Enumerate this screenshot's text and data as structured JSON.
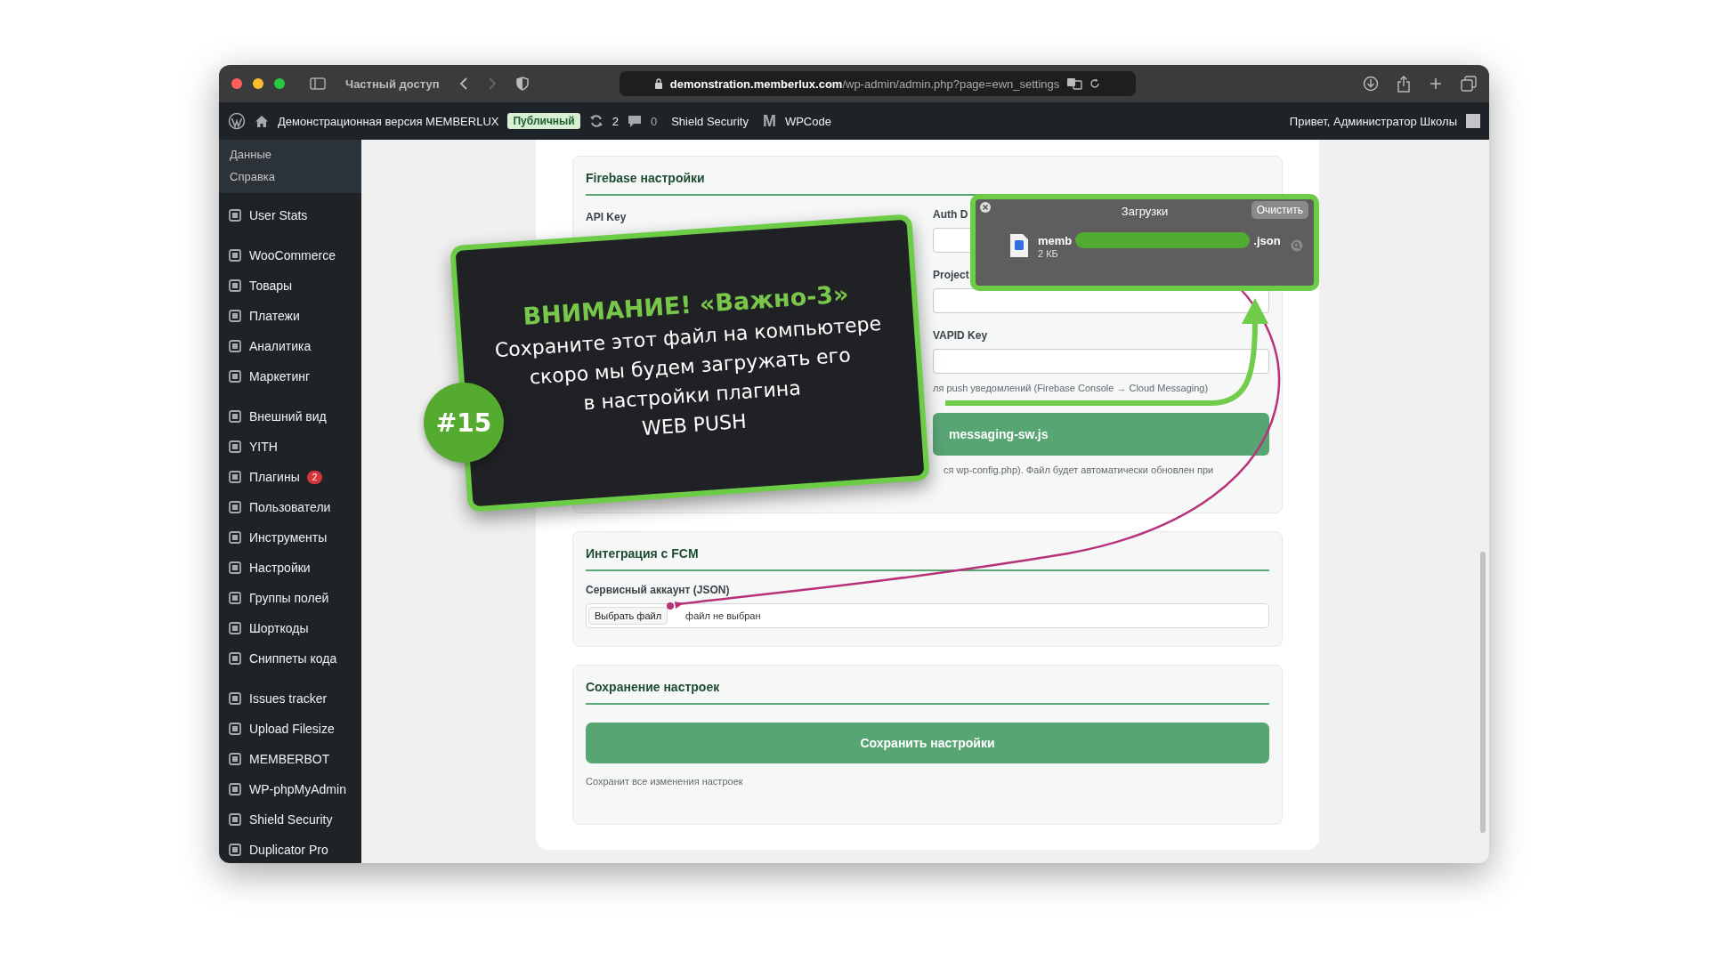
{
  "browser": {
    "tab_label": "Частный доступ",
    "url_host": "demonstration.memberlux.com",
    "url_path": "/wp-admin/admin.php?page=ewn_settings"
  },
  "admin_bar": {
    "site_name": "Демонстрационная версия MEMBERLUX",
    "badge": "Публичный",
    "updates": "2",
    "comments": "0",
    "security": "Shield Security",
    "logo_letter": "M",
    "plugin": "WPCode",
    "greeting": "Привет, Администратор Школы"
  },
  "sidebar": {
    "submenu": [
      "Данные",
      "Справка"
    ],
    "groups": [
      {
        "items": [
          {
            "label": "User Stats"
          }
        ]
      },
      {
        "items": [
          {
            "label": "WooCommerce"
          },
          {
            "label": "Товары"
          },
          {
            "label": "Платежи"
          },
          {
            "label": "Аналитика"
          },
          {
            "label": "Маркетинг"
          }
        ]
      },
      {
        "items": [
          {
            "label": "Внешний вид"
          },
          {
            "label": "YITH"
          },
          {
            "label": "Плагины",
            "badge": "2"
          },
          {
            "label": "Пользователи"
          },
          {
            "label": "Инструменты"
          },
          {
            "label": "Настройки"
          },
          {
            "label": "Группы полей"
          },
          {
            "label": "Шорткоды"
          },
          {
            "label": "Сниппеты кода"
          }
        ]
      },
      {
        "items": [
          {
            "label": "Issues tracker"
          },
          {
            "label": "Upload Filesize"
          },
          {
            "label": "MEMBERBOT"
          },
          {
            "label": "WP-phpMyAdmin"
          },
          {
            "label": "Shield Security"
          },
          {
            "label": "Duplicator Pro"
          }
        ]
      }
    ]
  },
  "firebase": {
    "title": "Firebase настройки",
    "left_label": "API Key",
    "fields": [
      {
        "label": "Auth D"
      },
      {
        "label": "Project"
      },
      {
        "label": "VAPID Key",
        "help": "ля push уведомлений (Firebase Console → Cloud Messaging)"
      }
    ],
    "button": "messaging-sw.js",
    "note": "ся wp-config.php). Файл будет автоматически обновлен при"
  },
  "fcm": {
    "title": "Интеграция с FCM",
    "label": "Сервисный аккаунт (JSON)",
    "choose": "Выбрать файл",
    "no_file": "файл не выбран"
  },
  "save": {
    "title": "Сохранение настроек",
    "button": "Сохранить настройки",
    "help": "Сохранит все изменения настроек"
  },
  "downloads": {
    "title": "Загрузки",
    "clear": "Очистить",
    "file_start": "memb",
    "file_end": ".json",
    "size": "2 КБ"
  },
  "callout": {
    "heading": "ВНИМАНИЕ! «Важно-3»",
    "lines": [
      "Сохраните этот файл на компьютере",
      "скоро мы будем загружать его",
      "в настройки плагина",
      "WEB PUSH"
    ],
    "number": "#15"
  }
}
